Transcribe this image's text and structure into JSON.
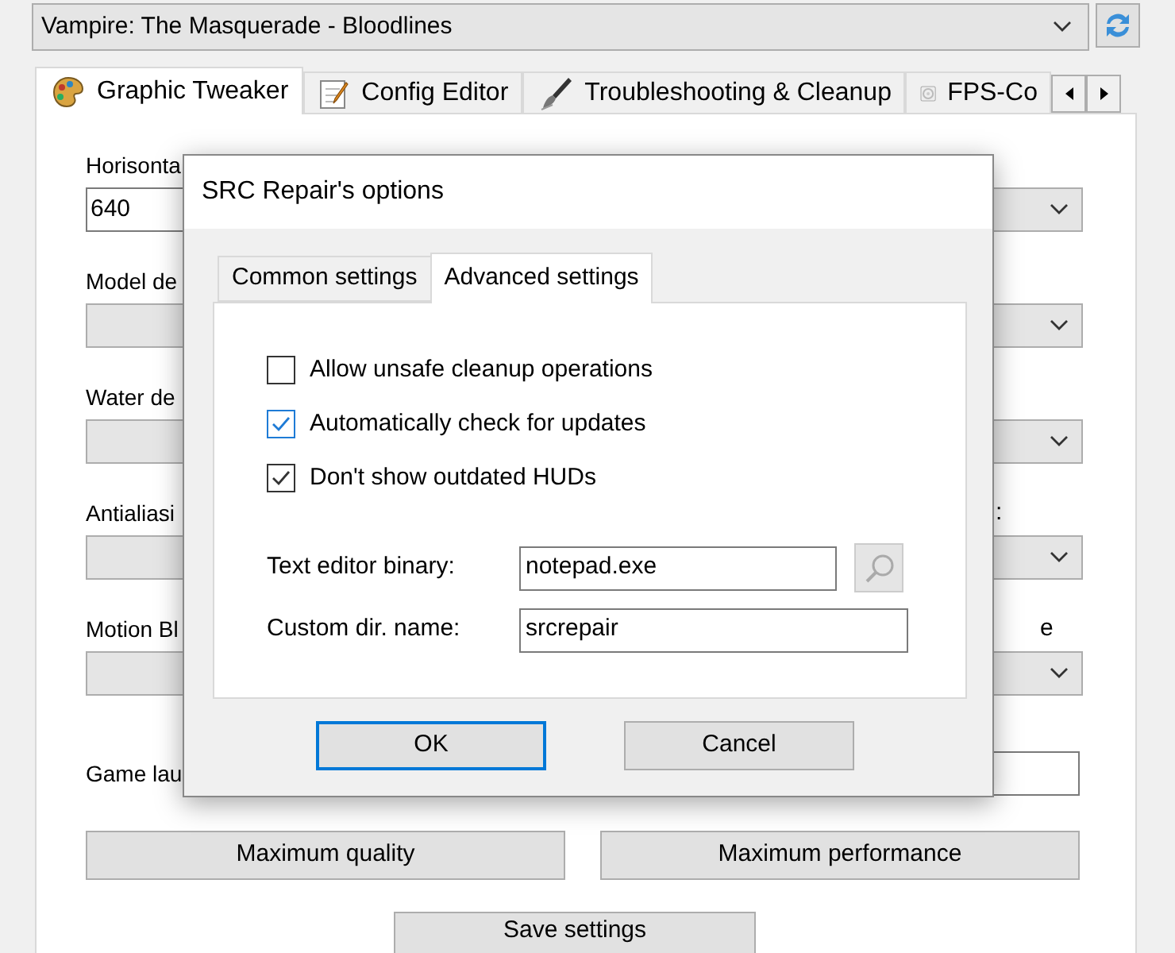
{
  "game_selector": {
    "value": "Vampire: The Masquerade - Bloodlines"
  },
  "tabs": [
    {
      "label": "Graphic Tweaker",
      "selected": true
    },
    {
      "label": "Config Editor",
      "selected": false
    },
    {
      "label": "Troubleshooting & Cleanup",
      "selected": false
    },
    {
      "label": "FPS-Co",
      "selected": false
    }
  ],
  "settings": [
    {
      "left_label": "Horisonta",
      "left_value": "640",
      "kind": "input"
    },
    {
      "left_label": "Model de",
      "kind": "select"
    },
    {
      "left_label": "Water de",
      "kind": "select"
    },
    {
      "left_label": "Antialiasi",
      "kind": "select",
      "right_label": ":"
    },
    {
      "left_label": "Motion Bl",
      "kind": "select",
      "right_label": "e"
    }
  ],
  "game_launch": {
    "label": "Game lau"
  },
  "buttons": [
    "Maximum quality",
    "Maximum performance"
  ],
  "save_button": "Save settings",
  "dialog": {
    "title": "SRC Repair's options",
    "tabs": [
      {
        "label": "Common settings",
        "selected": false
      },
      {
        "label": "Advanced settings",
        "selected": true
      }
    ],
    "checkboxes": [
      {
        "label": "Allow unsafe cleanup operations",
        "checked": false,
        "focused": false
      },
      {
        "label": "Automatically check for updates",
        "checked": true,
        "focused": true
      },
      {
        "label": "Don't show outdated HUDs",
        "checked": true,
        "focused": false
      }
    ],
    "fields": [
      {
        "label": "Text editor binary:",
        "value": "notepad.exe",
        "browse": true
      },
      {
        "label": "Custom dir. name:",
        "value": "srcrepair",
        "browse": false
      }
    ],
    "buttons": [
      {
        "label": "OK",
        "default": true
      },
      {
        "label": "Cancel",
        "default": false
      }
    ]
  }
}
